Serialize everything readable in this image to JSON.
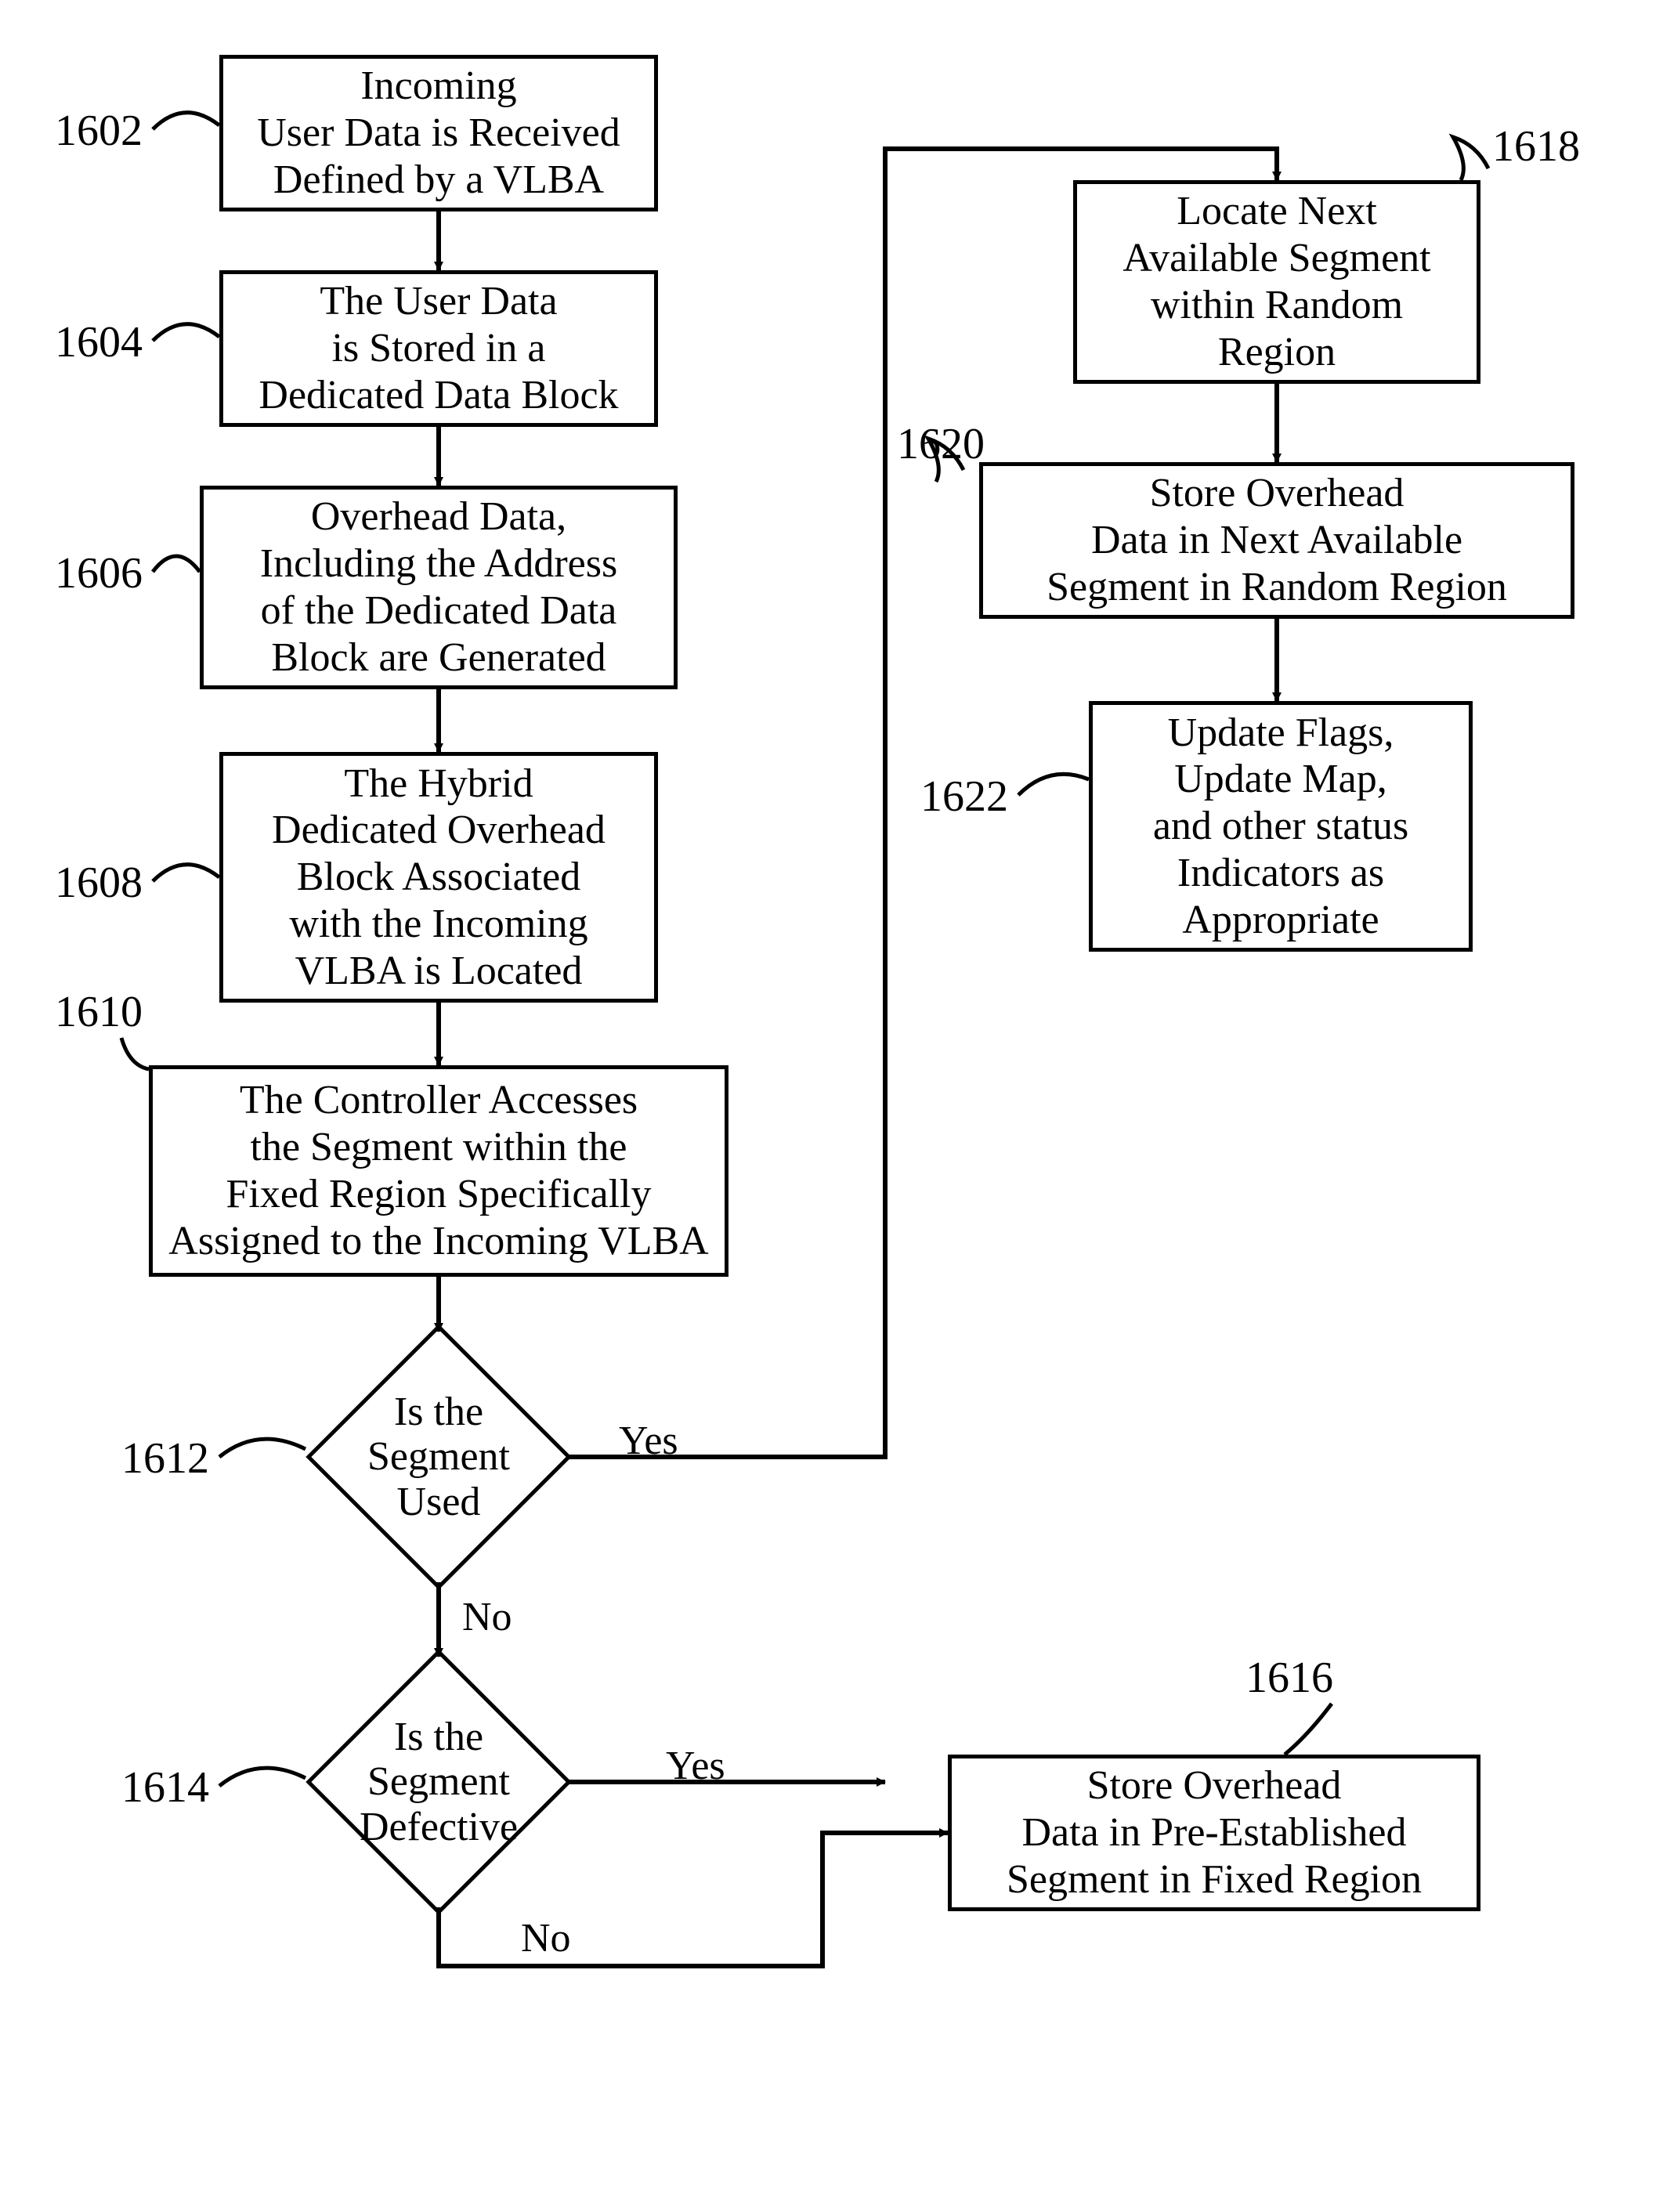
{
  "nodes": {
    "n1602": "Incoming\nUser Data is Received\nDefined by a VLBA",
    "n1604": "The User Data\nis Stored in a\nDedicated Data Block",
    "n1606": "Overhead Data,\nIncluding the Address\nof the  Dedicated Data\nBlock are Generated",
    "n1608": "The Hybrid\nDedicated Overhead\nBlock Associated\nwith the Incoming\nVLBA is Located",
    "n1610": "The Controller Accesses\nthe Segment within the\nFixed Region Specifically\nAssigned to the Incoming VLBA",
    "n1612": "Is the\nSegment\nUsed",
    "n1614": "Is the\nSegment\nDefective",
    "n1616": "Store Overhead\nData in Pre-Established\nSegment in Fixed Region",
    "n1618": "Locate Next\nAvailable Segment\nwithin Random\nRegion",
    "n1620": "Store Overhead\nData in Next Available\nSegment in Random Region",
    "n1622": "Update Flags,\nUpdate Map,\nand other status\nIndicators as\nAppropriate"
  },
  "labels": {
    "l1602": "1602",
    "l1604": "1604",
    "l1606": "1606",
    "l1608": "1608",
    "l1610": "1610",
    "l1612": "1612",
    "l1614": "1614",
    "l1616": "1616",
    "l1618": "1618",
    "l1620": "1620",
    "l1622": "1622"
  },
  "branches": {
    "yes": "Yes",
    "no": "No"
  }
}
